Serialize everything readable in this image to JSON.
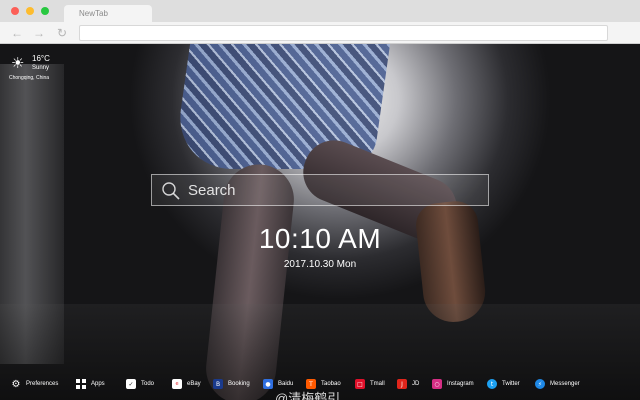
{
  "window": {
    "tab_title": "NewTab"
  },
  "toolbar": {
    "back_icon": "arrow-left-icon",
    "forward_icon": "arrow-right-icon",
    "reload_icon": "reload-icon",
    "address": ""
  },
  "weather": {
    "temperature": "16°C",
    "condition": "Sunny",
    "location": "Chongqing,  China",
    "icon": "sun-icon"
  },
  "search": {
    "placeholder": "Search"
  },
  "clock": {
    "time": "10:10 AM",
    "date": "2017.10.30 Mon"
  },
  "bottom_bar": {
    "items": [
      {
        "label": "Preferences",
        "icon": "gear-icon",
        "color": "#ffffff"
      },
      {
        "label": "Apps",
        "icon": "grid-icon",
        "color": "#ffffff"
      },
      {
        "label": "Todo",
        "icon": "checkbox-icon",
        "color": "#ffffff"
      },
      {
        "label": "eBay",
        "icon": "ebay-icon",
        "color": "#ffffff"
      },
      {
        "label": "Booking",
        "icon": "booking-icon",
        "color": "#1a3a8c"
      },
      {
        "label": "Baidu",
        "icon": "baidu-icon",
        "color": "#2f6fe0"
      },
      {
        "label": "Taobao",
        "icon": "taobao-icon",
        "color": "#ff5a00"
      },
      {
        "label": "Tmall",
        "icon": "tmall-icon",
        "color": "#e0102a"
      },
      {
        "label": "JD",
        "icon": "jd-icon",
        "color": "#e1251b"
      },
      {
        "label": "Instagram",
        "icon": "instagram-icon",
        "color": "#d62e84"
      },
      {
        "label": "Twitter",
        "icon": "twitter-icon",
        "color": "#1da1f2"
      },
      {
        "label": "Messenger",
        "icon": "messenger-icon",
        "color": "#1e88e5"
      }
    ]
  },
  "watermark": {
    "text": "@清梅鹤引"
  }
}
